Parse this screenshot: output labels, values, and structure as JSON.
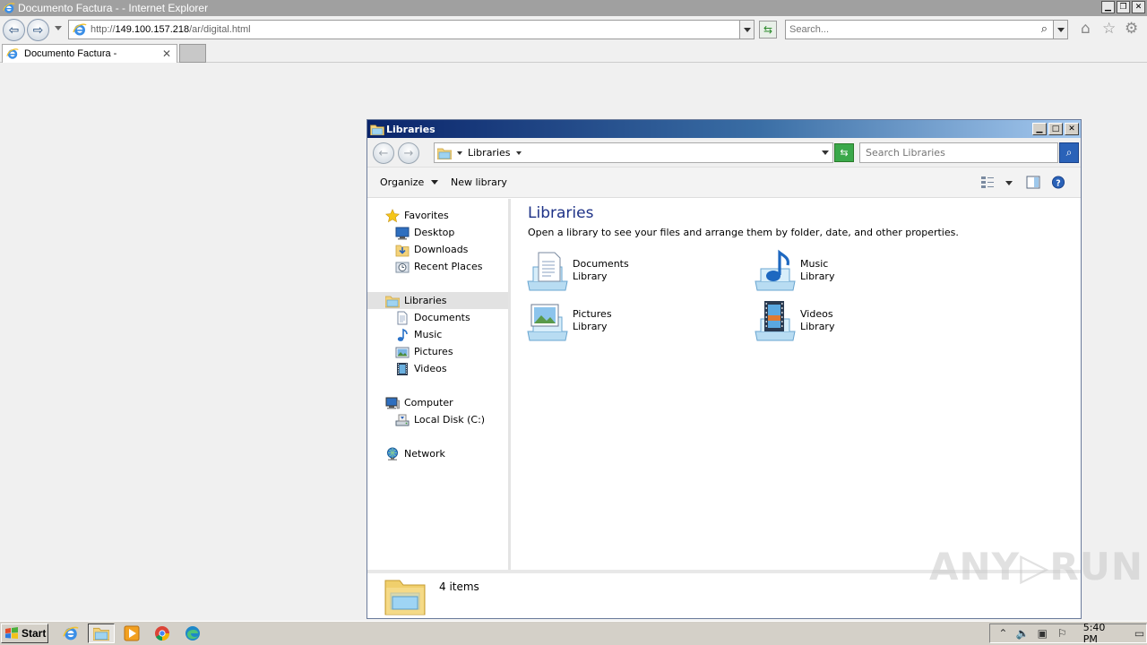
{
  "ie": {
    "window_title": "Documento Factura - - Internet Explorer",
    "url_prefix": "http://",
    "url_host": "149.100.157.218",
    "url_path": "/ar/digital.html",
    "search_placeholder": "Search...",
    "tab_label": "Documento Factura -",
    "tab_close": "✕"
  },
  "explorer": {
    "title": "Libraries",
    "breadcrumb": "Libraries",
    "search_placeholder": "Search Libraries",
    "toolbar": {
      "organize": "Organize",
      "new_library": "New library"
    },
    "nav": {
      "favorites": "Favorites",
      "desktop": "Desktop",
      "downloads": "Downloads",
      "recent_places": "Recent Places",
      "libraries": "Libraries",
      "documents": "Documents",
      "music": "Music",
      "pictures": "Pictures",
      "videos": "Videos",
      "computer": "Computer",
      "local_disk": "Local Disk (C:)",
      "network": "Network"
    },
    "main": {
      "heading": "Libraries",
      "description": "Open a library to see your files and arrange them by folder, date, and other properties.",
      "libraries": [
        {
          "name": "Documents",
          "type": "Library",
          "icon": "documents-library-icon"
        },
        {
          "name": "Music",
          "type": "Library",
          "icon": "music-library-icon"
        },
        {
          "name": "Pictures",
          "type": "Library",
          "icon": "pictures-library-icon"
        },
        {
          "name": "Videos",
          "type": "Library",
          "icon": "videos-library-icon"
        }
      ]
    },
    "status": "4 items"
  },
  "watermark": "ANY▷RUN",
  "taskbar": {
    "start_label": "Start",
    "clock": "5:40 PM"
  },
  "colors": {
    "title_gradient_start": "#0a246a",
    "title_gradient_end": "#a6caf0",
    "heading_blue": "#1e3287",
    "taskbar": "#d4d0c8"
  }
}
